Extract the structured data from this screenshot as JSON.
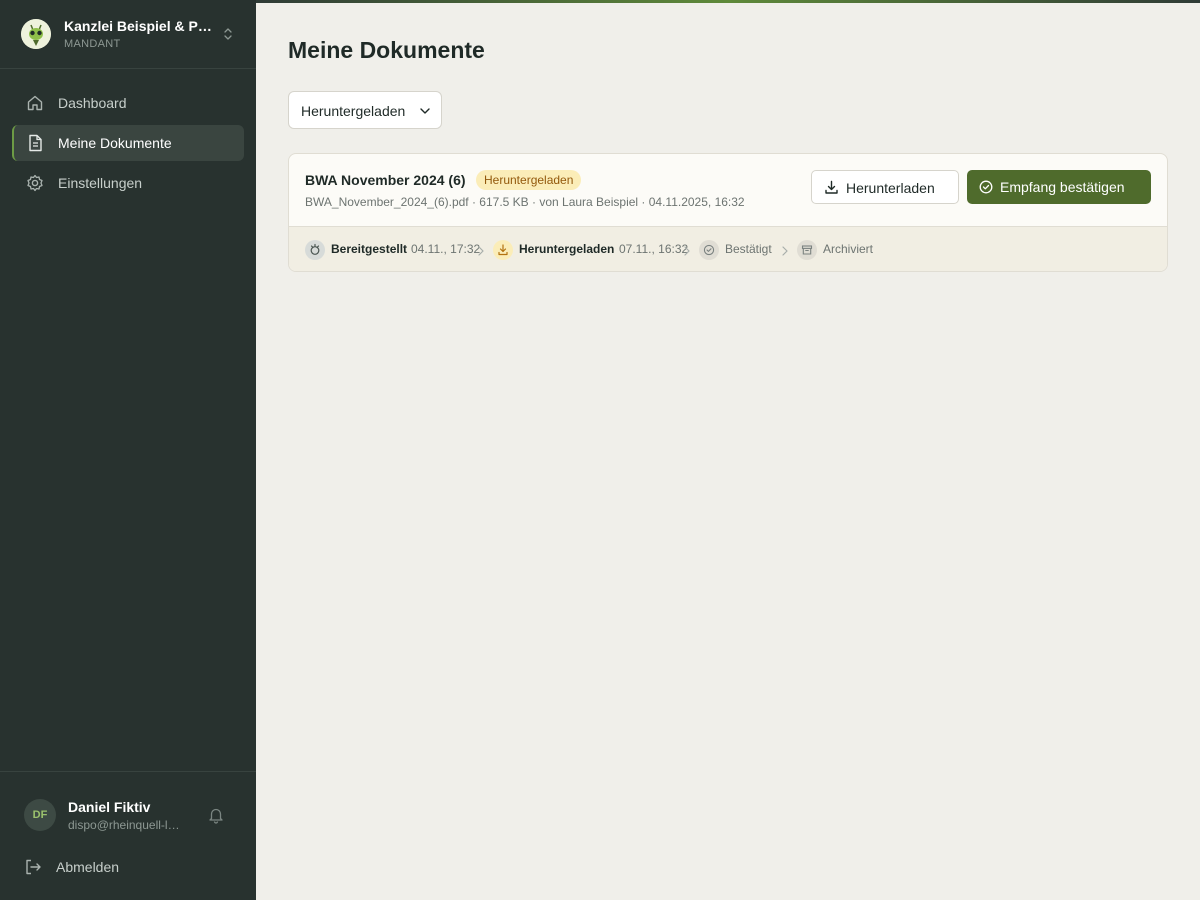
{
  "sidebar": {
    "org_name": "Kanzlei Beispiel & Partner",
    "org_role": "MANDANT",
    "nav": [
      {
        "label": "Dashboard",
        "icon": "home-icon"
      },
      {
        "label": "Meine Dokumente",
        "icon": "document-icon",
        "active": true
      },
      {
        "label": "Einstellungen",
        "icon": "gear-icon"
      }
    ],
    "user": {
      "initials": "DF",
      "name": "Daniel Fiktiv",
      "email": "dispo@rheinquell-logistik.de"
    },
    "logout_label": "Abmelden"
  },
  "main": {
    "title": "Meine Dokumente",
    "filter": {
      "selected": "Heruntergeladen"
    },
    "documents": [
      {
        "title": "BWA November 2024 (6)",
        "status_badge": "Heruntergeladen",
        "meta": "BWA_November_2024_(6).pdf · 617.5 KB · von Laura Beispiel · 04.11.2025, 16:32",
        "download_label": "Herunterladen",
        "confirm_label": "Empfang bestätigen",
        "timeline": [
          {
            "label": "Bereitgestellt",
            "time": "04.11., 17:32",
            "state": "done"
          },
          {
            "label": "Heruntergeladen",
            "time": "07.11., 16:32",
            "state": "done"
          },
          {
            "label": "Bestätigt",
            "time": "",
            "state": "pending"
          },
          {
            "label": "Archiviert",
            "time": "",
            "state": "pending"
          }
        ]
      }
    ]
  },
  "colors": {
    "sidebar_bg": "#28322f",
    "accent": "#4f6b2c",
    "badge_bg": "#fbedb8",
    "badge_text": "#93590c",
    "page_bg": "#f0efea"
  }
}
